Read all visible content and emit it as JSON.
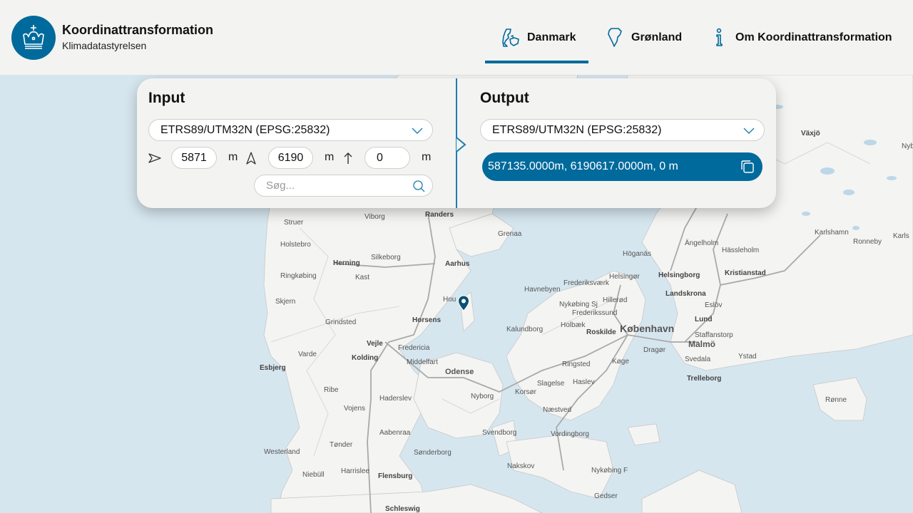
{
  "header": {
    "title": "Koordinattransformation",
    "subtitle": "Klimadatastyrelsen",
    "brand_color": "#006a9c",
    "nav": [
      {
        "label": "Danmark",
        "icon": "denmark-map-icon",
        "active": true
      },
      {
        "label": "Grønland",
        "icon": "greenland-map-icon",
        "active": false
      },
      {
        "label": "Om Koordinattransformation",
        "icon": "info-icon",
        "active": false
      }
    ]
  },
  "input": {
    "title": "Input",
    "crs": "ETRS89/UTM32N (EPSG:25832)",
    "easting": "5871",
    "northing": "6190",
    "height": "0",
    "unit": "m",
    "search_placeholder": "Søg..."
  },
  "output": {
    "title": "Output",
    "crs": "ETRS89/UTM32N (EPSG:25832)",
    "result": "587135.0000m, 6190617.0000m, 0 m"
  },
  "map": {
    "labels": {
      "viborg": "Viborg",
      "randers": "Randers",
      "struer": "Struer",
      "holstebro": "Holstebro",
      "silkeborg": "Silkeborg",
      "herning": "Herning",
      "aarhus": "Aarhus",
      "kast": "Kast",
      "ringkobing": "Ringkøbing",
      "skjern": "Skjern",
      "horsens": "Horsens",
      "hou": "Hou",
      "grindsted": "Grindsted",
      "vejle": "Vejle",
      "fredericia": "Fredericia",
      "varde": "Varde",
      "kolding": "Kolding",
      "esbjerg": "Esbjerg",
      "middelfart": "Middelfart",
      "odense": "Odense",
      "ribe": "Ribe",
      "haderslev": "Haderslev",
      "nyborg": "Nyborg",
      "vojens": "Vojens",
      "aabenraa": "Aabenraa",
      "svendborg": "Svendborg",
      "tonder": "Tønder",
      "sonderborg": "Sønderborg",
      "westerland": "Westerland",
      "niebull": "Niebüll",
      "harrislee": "Harrislee",
      "flensburg": "Flensburg",
      "schleswig": "Schleswig",
      "grenaa": "Grenaa",
      "hoganas": "Höganäs",
      "helsingor": "Helsingør",
      "helsingborg": "Helsingborg",
      "hillerod": "Hillerød",
      "frederiksvaerk": "Frederiksværk",
      "havnebyen": "Havnebyen",
      "nykobing_sj": "Nykøbing Sj",
      "frederikssund": "Frederikssund",
      "holbaek": "Holbæk",
      "roskilde": "Roskilde",
      "kobenhavn": "København",
      "kalundborg": "Kalundborg",
      "landskrona": "Landskrona",
      "eslov": "Eslöv",
      "lund": "Lund",
      "malmo": "Malmö",
      "staffanstorp": "Staffanstorp",
      "dragor": "Dragør",
      "svedala": "Svedala",
      "ystad": "Ystad",
      "trelleborg": "Trelleborg",
      "koge": "Køge",
      "ringsted": "Ringsted",
      "slagelse": "Slagelse",
      "haslev": "Haslev",
      "korsor": "Korsør",
      "naestved": "Næstved",
      "vordingborg": "Vordingborg",
      "nakskov": "Nakskov",
      "nykobing_f": "Nykøbing F",
      "gedser": "Gedser",
      "angelholm": "Ängelholm",
      "hassleholm": "Hässleholm",
      "kristianstad": "Kristianstad",
      "karlshamn": "Karlshamn",
      "ronneby": "Ronneby",
      "karls": "Karls",
      "vaxjo": "Växjö",
      "ronne": "Rønne",
      "nyb": "Nyb"
    }
  }
}
